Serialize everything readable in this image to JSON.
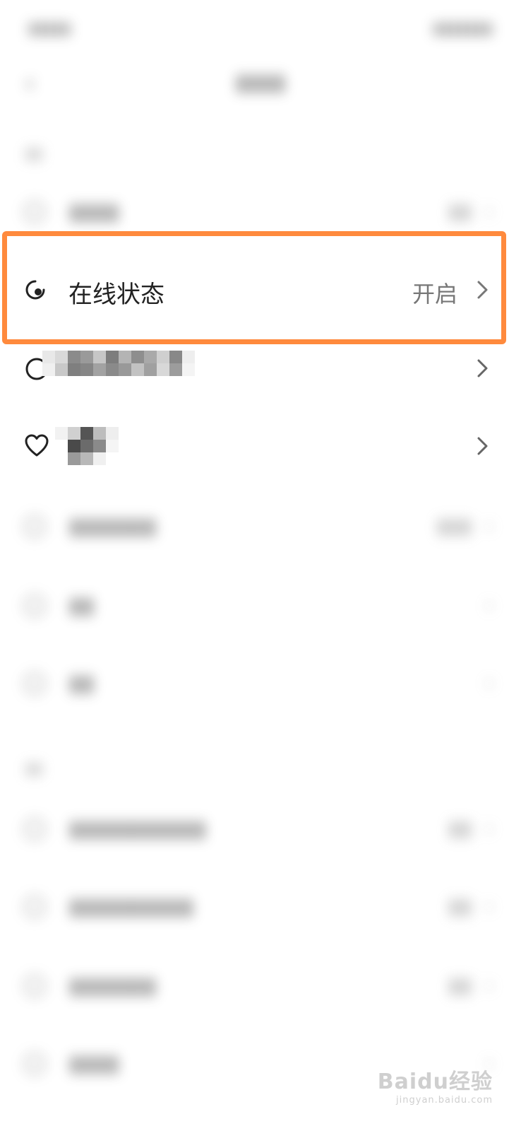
{
  "highlighted_row": {
    "label": "在线状态",
    "value": "开启",
    "icon": "online-status-icon"
  },
  "watermark": {
    "brand": "Baidu经验",
    "url": "jingyan.baidu.com"
  },
  "colors": {
    "highlight_border": "#ff8a3d",
    "label": "#222222",
    "value": "#777777"
  }
}
